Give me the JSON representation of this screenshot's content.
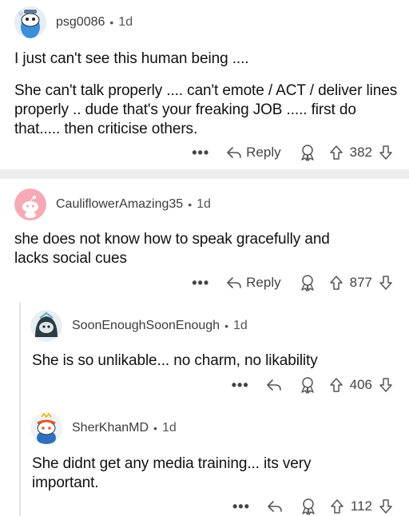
{
  "comments": [
    {
      "username": "psg0086",
      "age": "1d",
      "paragraphs": [
        "I just can't see this human being ....",
        "She can't talk properly .... can't emote / ACT / deliver lines properly  .. dude that's your freaking JOB ..... first do that..... then criticise others."
      ],
      "reply_label": "Reply",
      "votes": "382",
      "avatar_icon": "snoo-avatar-blue"
    },
    {
      "username": "CauliflowerAmazing35",
      "age": "1d",
      "paragraphs": [
        "she does not know how to speak gracefully and lacks social cues"
      ],
      "reply_label": "Reply",
      "votes": "877",
      "avatar_icon": "default-snoo-avatar-pink"
    },
    {
      "username": "SoonEnoughSoonEnough",
      "age": "1d",
      "paragraphs": [
        "She is so unlikable... no charm, no likability"
      ],
      "votes": "406",
      "avatar_icon": "snoo-avatar-dark-hood"
    },
    {
      "username": "SherKhanMD",
      "age": "1d",
      "paragraphs": [
        "She didnt get any media training... its very important."
      ],
      "votes": "112",
      "avatar_icon": "snoo-avatar-headband"
    }
  ],
  "ui": {
    "more_glyph": "•••",
    "dot": "•"
  },
  "colors": {
    "separator": "#ededed",
    "pink_avatar": "#f7a9b6",
    "text": "#1a1a1b"
  }
}
